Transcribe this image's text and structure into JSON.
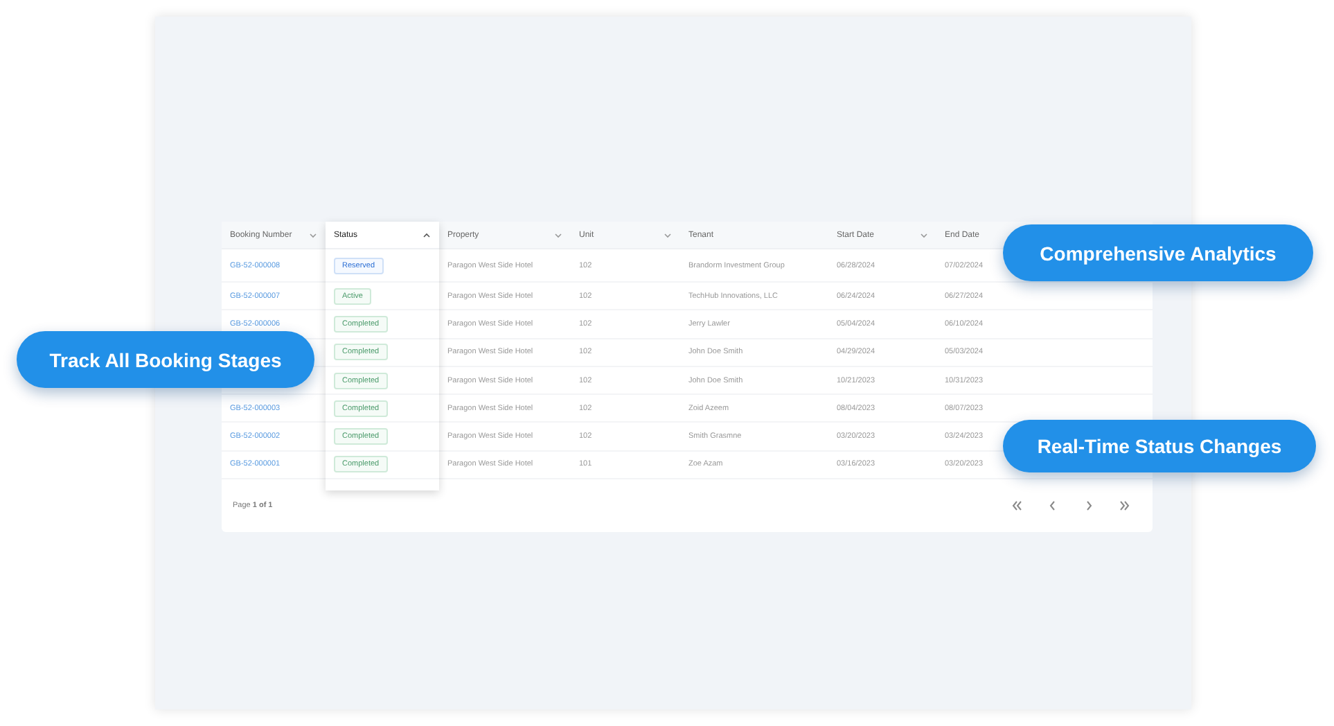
{
  "table": {
    "columns": [
      {
        "label": "Booking Number",
        "kind": "descending"
      },
      {
        "label": "Status",
        "kind": "ascending"
      },
      {
        "label": "Property",
        "kind": "descending"
      },
      {
        "label": "Unit",
        "kind": "descending"
      },
      {
        "label": "Tenant",
        "kind": "plain"
      },
      {
        "label": "Start Date",
        "kind": "descending"
      },
      {
        "label": "End Date",
        "kind": "plain"
      }
    ],
    "rows": [
      {
        "booking": "GB-52-000008",
        "status": {
          "label": "Reserved",
          "kind": "reserved"
        },
        "property": "Paragon West Side Hotel",
        "unit": "102",
        "tenant": "Brandorm Investment Group",
        "start": "06/28/2024",
        "end": "07/02/2024"
      },
      {
        "booking": "GB-52-000007",
        "status": {
          "label": "Active",
          "kind": "active"
        },
        "property": "Paragon West Side Hotel",
        "unit": "102",
        "tenant": "TechHub Innovations, LLC",
        "start": "06/24/2024",
        "end": "06/27/2024"
      },
      {
        "booking": "GB-52-000006",
        "status": {
          "label": "Completed",
          "kind": "completed"
        },
        "property": "Paragon West Side Hotel",
        "unit": "102",
        "tenant": "Jerry Lawler",
        "start": "05/04/2024",
        "end": "06/10/2024"
      },
      {
        "status": {
          "label": "Completed",
          "kind": "completed"
        },
        "property": "Paragon West Side Hotel",
        "unit": "102",
        "tenant": "John Doe Smith",
        "start": "04/29/2024",
        "end": "05/03/2024"
      },
      {
        "status": {
          "label": "Completed",
          "kind": "completed"
        },
        "property": "Paragon West Side Hotel",
        "unit": "102",
        "tenant": "John Doe Smith",
        "start": "10/21/2023",
        "end": "10/31/2023"
      },
      {
        "booking": "GB-52-000003",
        "status": {
          "label": "Completed",
          "kind": "completed"
        },
        "property": "Paragon West Side Hotel",
        "unit": "102",
        "tenant": "Zoid Azeem",
        "start": "08/04/2023",
        "end": "08/07/2023"
      },
      {
        "booking": "GB-52-000002",
        "status": {
          "label": "Completed",
          "kind": "completed"
        },
        "property": "Paragon West Side Hotel",
        "unit": "102",
        "tenant": "Smith Grasmne",
        "start": "03/20/2023",
        "end": "03/24/2023"
      },
      {
        "booking": "GB-52-000001",
        "status": {
          "label": "Completed",
          "kind": "completed"
        },
        "property": "Paragon West Side Hotel",
        "unit": "101",
        "tenant": "Zoe Azam",
        "start": "03/16/2023",
        "end": "03/20/2023"
      }
    ],
    "footer": {
      "prefix": "Page ",
      "page": "1 of 1"
    }
  },
  "callouts": [
    {
      "label": "Comprehensive Analytics"
    },
    {
      "label": "Track All Booking Stages"
    },
    {
      "label": "Real-Time Status Changes"
    }
  ]
}
